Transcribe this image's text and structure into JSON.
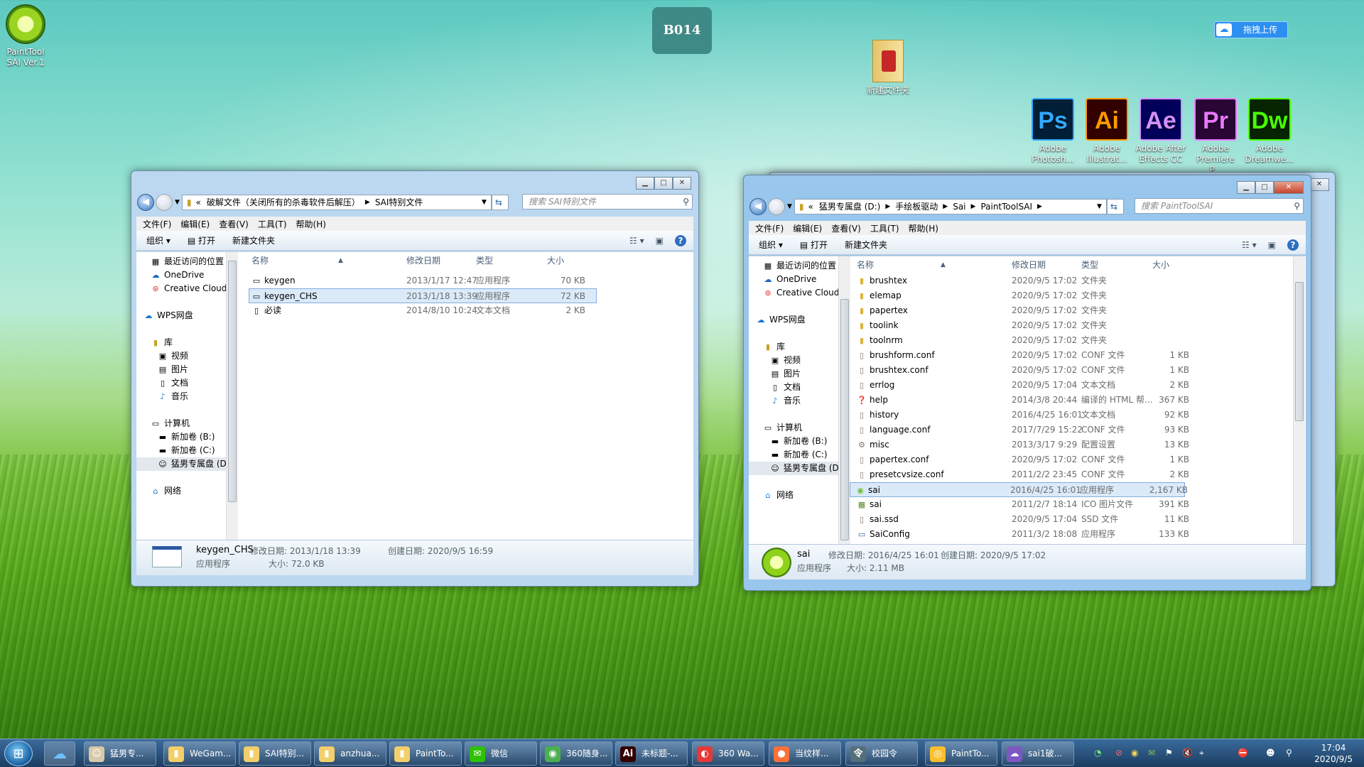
{
  "desktop": {
    "icons": [
      {
        "label_1": "PaintTool",
        "label_2": "SAI Ver.1"
      },
      {
        "label_1": "新建文件夹"
      }
    ],
    "adobe": [
      {
        "abbr": "Ps",
        "line1": "Adobe",
        "line2": "Photosh...",
        "color": "#31a8ff",
        "bg": "#001e36"
      },
      {
        "abbr": "Ai",
        "line1": "Adobe",
        "line2": "Illustrat...",
        "color": "#ff9a00",
        "bg": "#330000"
      },
      {
        "abbr": "Ae",
        "line1": "Adobe After",
        "line2": "Effects CC ...",
        "color": "#d291ff",
        "bg": "#00005b"
      },
      {
        "abbr": "Pr",
        "line1": "Adobe",
        "line2": "Premiere P...",
        "color": "#ea77ff",
        "bg": "#2a0634"
      },
      {
        "abbr": "Dw",
        "line1": "Adobe",
        "line2": "Dreamwe...",
        "color": "#46ff00",
        "bg": "#072401"
      }
    ],
    "badge": "B014",
    "upload_label": "拖拽上传"
  },
  "win1": {
    "breadcrumb": [
      "«",
      "破解文件（关闭所有的杀毒软件后解压）",
      "SAI特别文件"
    ],
    "search_placeholder": "搜索 SAI特别文件",
    "menu": [
      "文件(F)",
      "编辑(E)",
      "查看(V)",
      "工具(T)",
      "帮助(H)"
    ],
    "toolbar": {
      "organize": "组织 ▾",
      "open": "打开",
      "new_folder": "新建文件夹"
    },
    "nav": [
      "最近访问的位置",
      "OneDrive",
      "Creative Cloud",
      "",
      "WPS网盘",
      "",
      "库",
      "视频",
      "图片",
      "文档",
      "音乐",
      "",
      "计算机",
      "新加卷 (B:)",
      "新加卷 (C:)",
      "猛男专属盘 (D:)",
      "",
      "网络"
    ],
    "columns": [
      "名称",
      "修改日期",
      "类型",
      "大小"
    ],
    "rows": [
      {
        "name": "keygen",
        "date": "2013/1/17 12:47",
        "type": "应用程序",
        "size": "70 KB"
      },
      {
        "name": "keygen_CHS",
        "date": "2013/1/18 13:39",
        "type": "应用程序",
        "size": "72 KB"
      },
      {
        "name": "必读",
        "date": "2014/8/10 10:24",
        "type": "文本文档",
        "size": "2 KB"
      }
    ],
    "details": {
      "name": "keygen_CHS",
      "modified_label": "修改日期: 2013/1/18 13:39",
      "created_label": "创建日期: 2020/9/5 16:59",
      "type": "应用程序",
      "size_label": "大小: 72.0 KB"
    }
  },
  "win2": {
    "breadcrumb": [
      "«",
      "猛男专属盘 (D:)",
      "手绘板驱动",
      "Sai",
      "PaintToolSAI"
    ],
    "search_placeholder": "搜索 PaintToolSAI",
    "menu": [
      "文件(F)",
      "编辑(E)",
      "查看(V)",
      "工具(T)",
      "帮助(H)"
    ],
    "toolbar": {
      "organize": "组织 ▾",
      "open": "打开",
      "new_folder": "新建文件夹"
    },
    "nav": [
      "最近访问的位置",
      "OneDrive",
      "Creative Cloud",
      "",
      "WPS网盘",
      "",
      "库",
      "视频",
      "图片",
      "文档",
      "音乐",
      "",
      "计算机",
      "新加卷 (B:)",
      "新加卷 (C:)",
      "猛男专属盘 (D:)",
      "",
      "网络"
    ],
    "columns": [
      "名称",
      "修改日期",
      "类型",
      "大小"
    ],
    "rows": [
      {
        "name": "brushtex",
        "date": "2020/9/5 17:02",
        "type": "文件夹",
        "size": "",
        "kind": "folder"
      },
      {
        "name": "elemap",
        "date": "2020/9/5 17:02",
        "type": "文件夹",
        "size": "",
        "kind": "folder"
      },
      {
        "name": "papertex",
        "date": "2020/9/5 17:02",
        "type": "文件夹",
        "size": "",
        "kind": "folder"
      },
      {
        "name": "toolink",
        "date": "2020/9/5 17:02",
        "type": "文件夹",
        "size": "",
        "kind": "folder"
      },
      {
        "name": "toolnrm",
        "date": "2020/9/5 17:02",
        "type": "文件夹",
        "size": "",
        "kind": "folder"
      },
      {
        "name": "brushform.conf",
        "date": "2020/9/5 17:02",
        "type": "CONF 文件",
        "size": "1 KB",
        "kind": "file"
      },
      {
        "name": "brushtex.conf",
        "date": "2020/9/5 17:02",
        "type": "CONF 文件",
        "size": "1 KB",
        "kind": "file"
      },
      {
        "name": "errlog",
        "date": "2020/9/5 17:04",
        "type": "文本文档",
        "size": "2 KB",
        "kind": "file"
      },
      {
        "name": "help",
        "date": "2014/3/8 20:44",
        "type": "编译的 HTML 帮...",
        "size": "367 KB",
        "kind": "help"
      },
      {
        "name": "history",
        "date": "2016/4/25 16:01",
        "type": "文本文档",
        "size": "92 KB",
        "kind": "file"
      },
      {
        "name": "language.conf",
        "date": "2017/7/29 15:22",
        "type": "CONF 文件",
        "size": "93 KB",
        "kind": "file"
      },
      {
        "name": "misc",
        "date": "2013/3/17 9:29",
        "type": "配置设置",
        "size": "13 KB",
        "kind": "cfg"
      },
      {
        "name": "papertex.conf",
        "date": "2020/9/5 17:02",
        "type": "CONF 文件",
        "size": "1 KB",
        "kind": "file"
      },
      {
        "name": "presetcvsize.conf",
        "date": "2011/2/2 23:45",
        "type": "CONF 文件",
        "size": "2 KB",
        "kind": "file"
      },
      {
        "name": "sai",
        "date": "2016/4/25 16:01",
        "type": "应用程序",
        "size": "2,167 KB",
        "kind": "app"
      },
      {
        "name": "sai",
        "date": "2011/2/7 18:14",
        "type": "ICO 图片文件",
        "size": "391 KB",
        "kind": "ico"
      },
      {
        "name": "sai.ssd",
        "date": "2020/9/5 17:04",
        "type": "SSD 文件",
        "size": "11 KB",
        "kind": "file"
      },
      {
        "name": "SaiConfig",
        "date": "2011/3/2 18:08",
        "type": "应用程序",
        "size": "133 KB",
        "kind": "exe"
      }
    ],
    "details": {
      "name": "sai",
      "modified_label": "修改日期: 2016/4/25 16:01",
      "created_label": "创建日期: 2020/9/5 17:02",
      "type": "应用程序",
      "size_label": "大小: 2.11 MB"
    }
  },
  "taskbar": {
    "items": [
      {
        "label": "猛男专...",
        "icon": "avatar-icon",
        "glyph": "☺",
        "color": "#d8c9a8"
      },
      {
        "label": "WeGam...",
        "icon": "folder-icon",
        "glyph": "▮",
        "color": "#f2cf6a"
      },
      {
        "label": "SAI特别...",
        "icon": "folder-icon",
        "glyph": "▮",
        "color": "#f2cf6a"
      },
      {
        "label": "anzhua...",
        "icon": "folder-icon",
        "glyph": "▮",
        "color": "#f2cf6a"
      },
      {
        "label": "PaintTo...",
        "icon": "folder-icon",
        "glyph": "▮",
        "color": "#f2cf6a"
      },
      {
        "label": "微信",
        "icon": "wechat-icon",
        "glyph": "✉",
        "color": "#2dc100"
      },
      {
        "label": "360随身...",
        "icon": "wifi-icon",
        "glyph": "◉",
        "color": "#4caf50"
      },
      {
        "label": "未标题-...",
        "icon": "illustrator-icon",
        "glyph": "Ai",
        "color": "#330000"
      },
      {
        "label": "360 Wa...",
        "icon": "360-icon",
        "glyph": "◐",
        "color": "#e53935"
      },
      {
        "label": "当纹样...",
        "icon": "firefox-icon",
        "glyph": "●",
        "color": "#ff7139"
      },
      {
        "label": "校园令",
        "icon": "campus-icon",
        "glyph": "令",
        "color": "#546e7a"
      },
      {
        "label": "PaintTo...",
        "icon": "chrome-icon",
        "glyph": "◎",
        "color": "#fbc02d"
      },
      {
        "label": "sai1破...",
        "icon": "cloud-icon",
        "glyph": "☁",
        "color": "#7e57c2"
      }
    ],
    "time": "17:04",
    "date": "2020/9/5"
  }
}
